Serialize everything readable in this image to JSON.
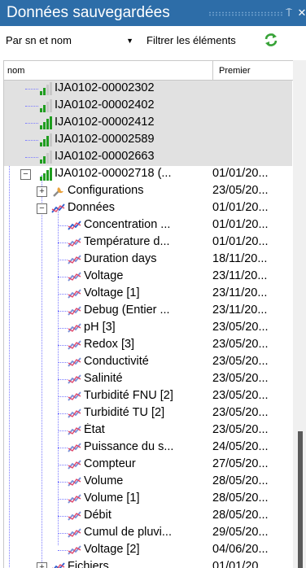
{
  "panel": {
    "title": "Données sauvegardées",
    "pin_glyph": "⍑",
    "close_glyph": "✕"
  },
  "toolbar": {
    "group_by": "Par sn et nom",
    "filter_label": "Filtrer les éléments",
    "refresh_icon": "refresh-icon"
  },
  "columns": {
    "name": "nom",
    "first": "Premier"
  },
  "colors": {
    "title_bar": "#2d6da8",
    "selection_row": "#e1e1e1",
    "tree_lines": "#7b7bff",
    "signal_green": "#1f9d1f"
  },
  "tree": {
    "devices": [
      {
        "label": "IJA0102-00002302",
        "first": ""
      },
      {
        "label": "IJA0102-00002402",
        "first": ""
      },
      {
        "label": "IJA0102-00002412",
        "first": ""
      },
      {
        "label": "IJA0102-00002589",
        "first": ""
      },
      {
        "label": "IJA0102-00002663",
        "first": ""
      },
      {
        "label": "IJA0102-00002718 (...",
        "first": "01/01/20..."
      }
    ],
    "groups": [
      {
        "label": "Configurations",
        "first": "23/05/20...",
        "expanded": false
      },
      {
        "label": "Données",
        "first": "01/01/20...",
        "expanded": true
      },
      {
        "label": "Fichiers",
        "first": "01/01/20...",
        "expanded": false
      }
    ],
    "measures": [
      {
        "label": "Concentration ...",
        "first": "01/01/20..."
      },
      {
        "label": "Température d...",
        "first": "01/01/20..."
      },
      {
        "label": "Duration days",
        "first": "18/11/20..."
      },
      {
        "label": "Voltage",
        "first": "23/11/20..."
      },
      {
        "label": "Voltage [1]",
        "first": "23/11/20..."
      },
      {
        "label": "Debug (Entier ...",
        "first": "23/11/20..."
      },
      {
        "label": "pH [3]",
        "first": "23/05/20..."
      },
      {
        "label": "Redox [3]",
        "first": "23/05/20..."
      },
      {
        "label": "Conductivité",
        "first": "23/05/20..."
      },
      {
        "label": "Salinité",
        "first": "23/05/20..."
      },
      {
        "label": "Turbidité FNU [2]",
        "first": "23/05/20..."
      },
      {
        "label": "Turbidité TU [2]",
        "first": "23/05/20..."
      },
      {
        "label": "État",
        "first": "23/05/20..."
      },
      {
        "label": "Puissance du s...",
        "first": "24/05/20..."
      },
      {
        "label": "Compteur",
        "first": "27/05/20..."
      },
      {
        "label": "Volume",
        "first": "28/05/20..."
      },
      {
        "label": "Volume [1]",
        "first": "28/05/20..."
      },
      {
        "label": "Débit",
        "first": "28/05/20..."
      },
      {
        "label": "Cumul de pluvi...",
        "first": "29/05/20..."
      },
      {
        "label": "Voltage [2]",
        "first": "04/06/20..."
      }
    ]
  }
}
